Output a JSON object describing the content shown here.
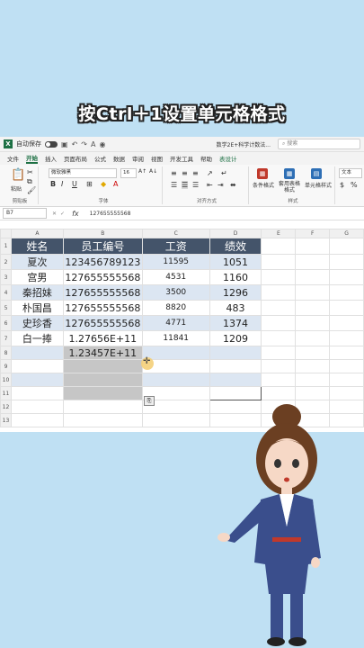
{
  "banner": "按Ctrl＋1设置单元格格式",
  "titlebar": {
    "autosave": "自动保存",
    "doc_name": "数学2E+科学计数法...",
    "search_placeholder": "搜索"
  },
  "menu": [
    "文件",
    "开始",
    "插入",
    "页面布局",
    "公式",
    "数据",
    "审阅",
    "视图",
    "开发工具",
    "帮助",
    "表设计"
  ],
  "ribbon": {
    "clipboard_label": "剪贴板",
    "paste": "粘贴",
    "font_name": "微软雅黑",
    "font_size": "16",
    "font_label": "字体",
    "align_label": "对齐方式",
    "cond_format": "条件格式",
    "table_format": "套用表格格式",
    "cell_style": "单元格样式",
    "style_label": "样式",
    "number_format": "文本"
  },
  "formula": {
    "name_box": "B7",
    "fx": "fx",
    "value": "127655555568"
  },
  "columns": [
    "A",
    "B",
    "C",
    "D",
    "E",
    "F",
    "G"
  ],
  "headers": [
    "姓名",
    "员工编号",
    "工资",
    "绩效"
  ],
  "rows": [
    {
      "n": "1",
      "a": "",
      "b": "",
      "c": "",
      "d": ""
    },
    {
      "n": "2",
      "a": "夏次",
      "b": "123456789123",
      "c": "11595",
      "d": "1051"
    },
    {
      "n": "3",
      "a": "宫男",
      "b": "127655555568",
      "c": "4531",
      "d": "1160"
    },
    {
      "n": "4",
      "a": "秦招妹",
      "b": "127655555568",
      "c": "3500",
      "d": "1296"
    },
    {
      "n": "5",
      "a": "朴国昌",
      "b": "127655555568",
      "c": "8820",
      "d": "483"
    },
    {
      "n": "6",
      "a": "史珍香",
      "b": "127655555568",
      "c": "4771",
      "d": "1374"
    },
    {
      "n": "7",
      "a": "白一捧",
      "b": "1.27656E+11",
      "c": "11841",
      "d": "1209"
    },
    {
      "n": "8",
      "a": "",
      "b": "1.23457E+11",
      "c": "",
      "d": ""
    },
    {
      "n": "9",
      "a": "",
      "b": "",
      "c": "",
      "d": ""
    },
    {
      "n": "10",
      "a": "",
      "b": "",
      "c": "",
      "d": ""
    },
    {
      "n": "11",
      "a": "",
      "b": "",
      "c": "",
      "d": ""
    },
    {
      "n": "12",
      "a": "",
      "b": "",
      "c": "",
      "d": ""
    },
    {
      "n": "13",
      "a": "",
      "b": "",
      "c": "",
      "d": ""
    }
  ]
}
